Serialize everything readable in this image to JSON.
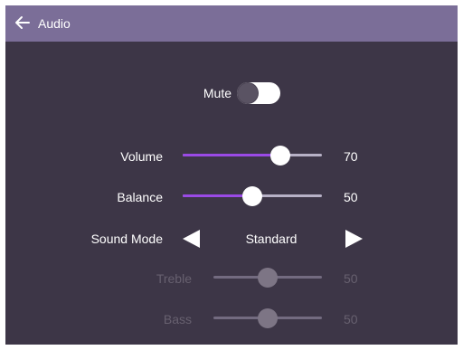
{
  "header": {
    "title": "Audio",
    "back_icon": "back-arrow-icon"
  },
  "mute": {
    "label": "Mute",
    "on": false
  },
  "volume": {
    "label": "Volume",
    "value": "70",
    "level": 0.7,
    "enabled": true
  },
  "balance": {
    "label": "Balance",
    "value": "50",
    "level": 0.5,
    "enabled": true
  },
  "sound_mode": {
    "label": "Sound Mode",
    "value": "Standard",
    "prev_icon": "arrow-left-icon",
    "next_icon": "arrow-right-icon"
  },
  "treble": {
    "label": "Treble",
    "value": "50",
    "level": 0.5,
    "enabled": false
  },
  "bass": {
    "label": "Bass",
    "value": "50",
    "level": 0.5,
    "enabled": false
  },
  "colors": {
    "header": "#7b6e98",
    "panel": "#3d3647",
    "accent": "#9a4ae6",
    "disabled_text": "#67606f"
  }
}
